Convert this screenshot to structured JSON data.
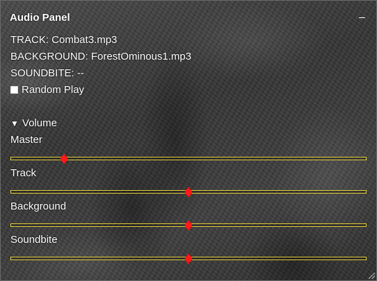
{
  "panel": {
    "title": "Audio Panel",
    "minimize_icon": "minimize-icon"
  },
  "now_playing": {
    "track": "TRACK: Combat3.mp3",
    "background": "BACKGROUND: ForestOminous1.mp3",
    "soundbite": "SOUNDBITE: --"
  },
  "random_play": {
    "label": "Random Play",
    "checked": false
  },
  "volume": {
    "header_icon": "triangle-down-icon",
    "header": "Volume",
    "sliders": [
      {
        "label": "Master",
        "value": 0.15
      },
      {
        "label": "Track",
        "value": 0.5
      },
      {
        "label": "Background",
        "value": 0.5
      },
      {
        "label": "Soundbite",
        "value": 0.5
      }
    ]
  },
  "colors": {
    "slider_track_border": "#e6cf3a",
    "slider_thumb": "#ff1a1a",
    "text": "#ffffff"
  }
}
